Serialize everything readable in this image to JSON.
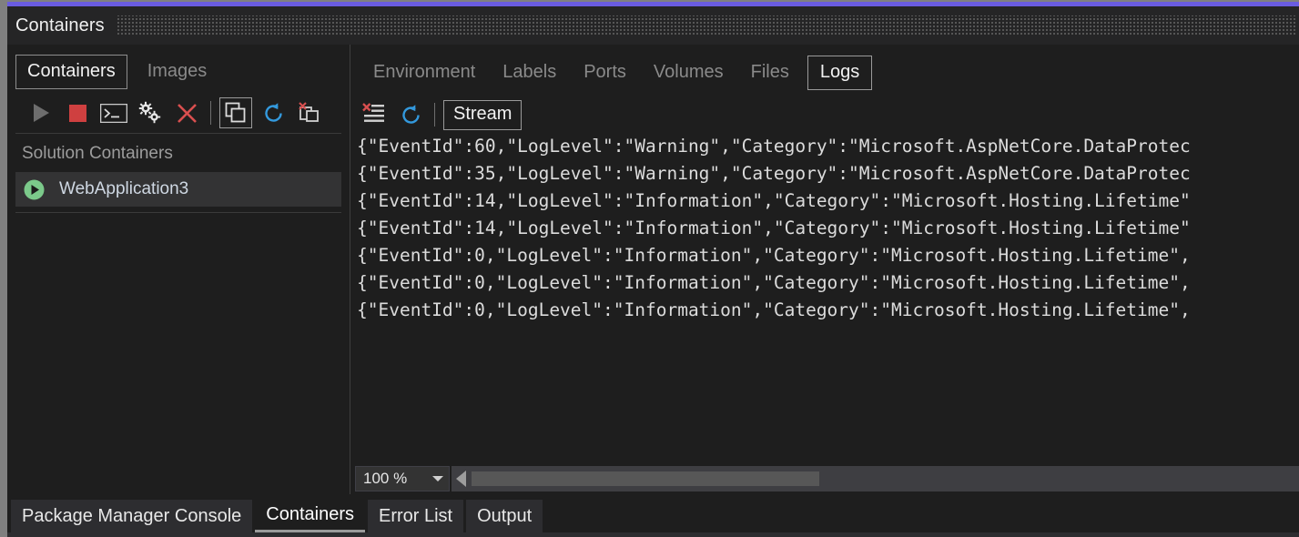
{
  "window": {
    "title": "Containers",
    "accent_color": "#6a5ce0",
    "background_color": "#1e1e1e",
    "drag_handle": "drag-dots-grip"
  },
  "left_pane": {
    "tabs": [
      {
        "label": "Containers",
        "selected": true
      },
      {
        "label": "Images",
        "selected": false
      }
    ],
    "toolbar": [
      {
        "name": "start-button",
        "icon": "play-triangle-icon",
        "color": "#6d6d6d"
      },
      {
        "name": "stop-button",
        "icon": "stop-square-icon",
        "color": "#cf4040"
      },
      {
        "name": "terminal-button",
        "icon": "terminal-prompt-icon",
        "color": "#d0d0d0"
      },
      {
        "name": "settings-button",
        "icon": "gears-icon",
        "color": "#e0e0e0"
      },
      {
        "name": "remove-button",
        "icon": "red-x-icon",
        "color": "#d94f4f"
      },
      {
        "name": "view-containers-button",
        "icon": "copy-windows-icon",
        "color": "#d8d8d8",
        "boxed": true
      },
      {
        "name": "refresh-button",
        "icon": "refresh-circular-arrow-icon",
        "color": "#3399dd"
      },
      {
        "name": "remove-container-button",
        "icon": "delete-container-icon",
        "color": "#d8d8d8"
      }
    ],
    "list_header": "Solution Containers",
    "containers": [
      {
        "name": "WebApplication3",
        "status_icon": "running-play-icon",
        "status_color": "#7bc98a",
        "selected": true
      }
    ]
  },
  "right_pane": {
    "tabs": [
      {
        "label": "Environment",
        "selected": false
      },
      {
        "label": "Labels",
        "selected": false
      },
      {
        "label": "Ports",
        "selected": false
      },
      {
        "label": "Volumes",
        "selected": false
      },
      {
        "label": "Files",
        "selected": false
      },
      {
        "label": "Logs",
        "selected": true
      }
    ],
    "log_toolbar": [
      {
        "name": "clear-logs-button",
        "icon": "clear-list-red-x-icon",
        "color": "#d94f4f"
      },
      {
        "name": "refresh-logs-button",
        "icon": "refresh-circular-arrow-icon",
        "color": "#3399dd"
      }
    ],
    "stream_button_label": "Stream",
    "log_lines": [
      "{\"EventId\":60,\"LogLevel\":\"Warning\",\"Category\":\"Microsoft.AspNetCore.DataProtec",
      "{\"EventId\":35,\"LogLevel\":\"Warning\",\"Category\":\"Microsoft.AspNetCore.DataProtec",
      "{\"EventId\":14,\"LogLevel\":\"Information\",\"Category\":\"Microsoft.Hosting.Lifetime\"",
      "{\"EventId\":14,\"LogLevel\":\"Information\",\"Category\":\"Microsoft.Hosting.Lifetime\"",
      "{\"EventId\":0,\"LogLevel\":\"Information\",\"Category\":\"Microsoft.Hosting.Lifetime\",",
      "{\"EventId\":0,\"LogLevel\":\"Information\",\"Category\":\"Microsoft.Hosting.Lifetime\",",
      "{\"EventId\":0,\"LogLevel\":\"Information\",\"Category\":\"Microsoft.Hosting.Lifetime\","
    ],
    "zoom_level": "100 %",
    "horizontal_scrollbar": {
      "left_arrow": "scroll-left-arrow-icon"
    }
  },
  "dock_tabs": [
    {
      "label": "Package Manager Console",
      "active": false
    },
    {
      "label": "Containers",
      "active": true
    },
    {
      "label": "Error List",
      "active": false
    },
    {
      "label": "Output",
      "active": false
    }
  ]
}
